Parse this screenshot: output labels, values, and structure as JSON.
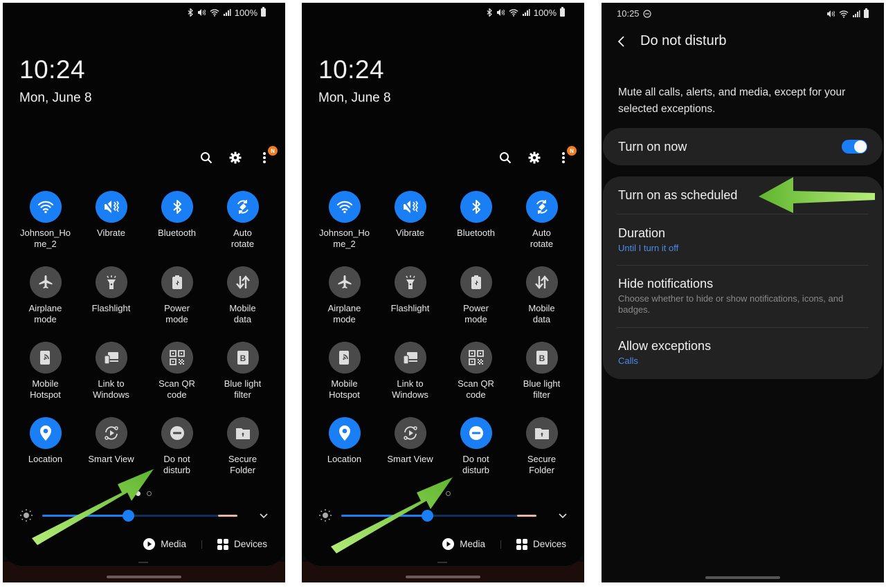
{
  "colors": {
    "accent_blue": "#1a7ef5",
    "tile_off": "#4a4a4a",
    "badge_orange": "#ef7a21",
    "link_blue": "#4a8bea",
    "annotation_arrow_green": "#7ac943"
  },
  "panels": [
    {
      "status_bar": {
        "icons": [
          "bluetooth-icon",
          "vibrate-icon",
          "wifi-icon",
          "signal-icon"
        ],
        "battery": "100%"
      },
      "clock": "10:24",
      "date": "Mon, June 8",
      "top_actions": {
        "search": "search-icon",
        "settings": "gear-icon",
        "more": "more-vertical-icon",
        "badge": "N"
      },
      "tiles": [
        {
          "label": "Johnson_Ho\nme_2",
          "icon": "wifi-icon",
          "on": true
        },
        {
          "label": "Vibrate",
          "icon": "vibrate-icon",
          "on": true
        },
        {
          "label": "Bluetooth",
          "icon": "bluetooth-icon",
          "on": true
        },
        {
          "label": "Auto\nrotate",
          "icon": "auto-rotate-icon",
          "on": true
        },
        {
          "label": "Airplane\nmode",
          "icon": "airplane-icon",
          "on": false
        },
        {
          "label": "Flashlight",
          "icon": "flashlight-icon",
          "on": false
        },
        {
          "label": "Power\nmode",
          "icon": "power-mode-icon",
          "on": false
        },
        {
          "label": "Mobile\ndata",
          "icon": "mobile-data-icon",
          "on": false
        },
        {
          "label": "Mobile\nHotspot",
          "icon": "hotspot-icon",
          "on": false
        },
        {
          "label": "Link to\nWindows",
          "icon": "link-windows-icon",
          "on": false
        },
        {
          "label": "Scan QR\ncode",
          "icon": "qr-code-icon",
          "on": false
        },
        {
          "label": "Blue light\nfilter",
          "icon": "blue-light-icon",
          "on": false
        },
        {
          "label": "Location",
          "icon": "location-icon",
          "on": true
        },
        {
          "label": "Smart View",
          "icon": "smart-view-icon",
          "on": false
        },
        {
          "label": "Do not\ndisturb",
          "icon": "do-not-disturb-icon",
          "on": false
        },
        {
          "label": "Secure\nFolder",
          "icon": "secure-folder-icon",
          "on": false
        }
      ],
      "page_indicator": {
        "pages": 2,
        "current": 1
      },
      "brightness_level": 0.44,
      "media_label": "Media",
      "devices_label": "Devices"
    },
    {
      "status_bar": {
        "icons": [
          "bluetooth-icon",
          "vibrate-icon",
          "wifi-icon",
          "signal-icon"
        ],
        "battery": "100%"
      },
      "clock": "10:24",
      "date": "Mon, June 8",
      "top_actions": {
        "search": "search-icon",
        "settings": "gear-icon",
        "more": "more-vertical-icon",
        "badge": "N"
      },
      "tiles": [
        {
          "label": "Johnson_Ho\nme_2",
          "icon": "wifi-icon",
          "on": true
        },
        {
          "label": "Vibrate",
          "icon": "vibrate-icon",
          "on": true
        },
        {
          "label": "Bluetooth",
          "icon": "bluetooth-icon",
          "on": true
        },
        {
          "label": "Auto\nrotate",
          "icon": "auto-rotate-icon",
          "on": true
        },
        {
          "label": "Airplane\nmode",
          "icon": "airplane-icon",
          "on": false
        },
        {
          "label": "Flashlight",
          "icon": "flashlight-icon",
          "on": false
        },
        {
          "label": "Power\nmode",
          "icon": "power-mode-icon",
          "on": false
        },
        {
          "label": "Mobile\ndata",
          "icon": "mobile-data-icon",
          "on": false
        },
        {
          "label": "Mobile\nHotspot",
          "icon": "hotspot-icon",
          "on": false
        },
        {
          "label": "Link to\nWindows",
          "icon": "link-windows-icon",
          "on": false
        },
        {
          "label": "Scan QR\ncode",
          "icon": "qr-code-icon",
          "on": false
        },
        {
          "label": "Blue light\nfilter",
          "icon": "blue-light-icon",
          "on": false
        },
        {
          "label": "Location",
          "icon": "location-icon",
          "on": true
        },
        {
          "label": "Smart View",
          "icon": "smart-view-icon",
          "on": false
        },
        {
          "label": "Do not\ndisturb",
          "icon": "do-not-disturb-icon",
          "on": true
        },
        {
          "label": "Secure\nFolder",
          "icon": "secure-folder-icon",
          "on": false
        }
      ],
      "page_indicator": {
        "pages": 2,
        "current": 1
      },
      "brightness_level": 0.44,
      "media_label": "Media",
      "devices_label": "Devices"
    }
  ],
  "settings": {
    "status_time": "10:25",
    "status_dnd_icon": "do-not-disturb-icon",
    "status_icons": [
      "vibrate-icon",
      "wifi-icon",
      "signal-icon",
      "battery-icon"
    ],
    "title": "Do not disturb",
    "description": "Mute all calls, alerts, and media, except for your selected exceptions.",
    "turn_on_now": {
      "label": "Turn on now",
      "enabled": true
    },
    "items": [
      {
        "title": "Turn on as scheduled"
      },
      {
        "title": "Duration",
        "subtitle": "Until I turn it off",
        "subtitle_style": "link"
      },
      {
        "title": "Hide notifications",
        "subtitle": "Choose whether to hide or show notifications, icons, and badges.",
        "subtitle_style": "grey"
      },
      {
        "title": "Allow exceptions",
        "subtitle": "Calls",
        "subtitle_style": "link"
      }
    ]
  }
}
